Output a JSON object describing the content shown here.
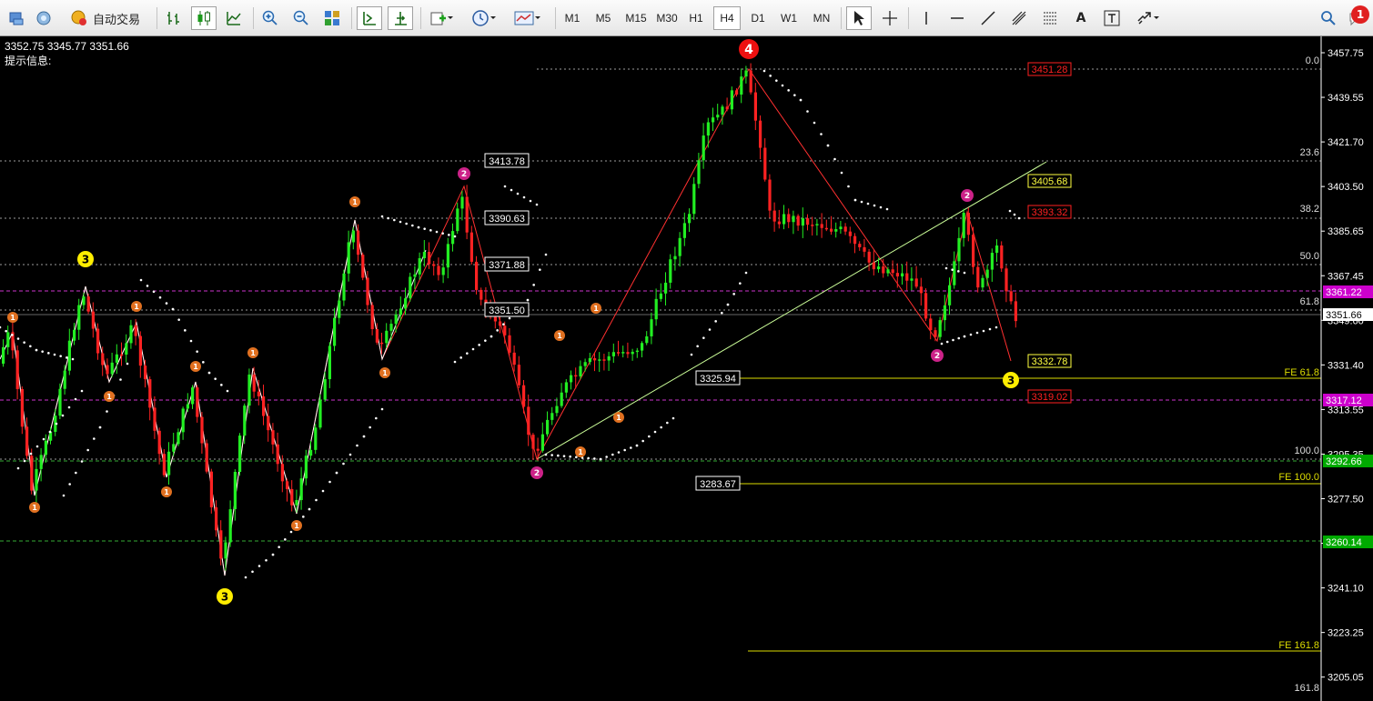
{
  "toolbar": {
    "auto_trade_label": "自动交易",
    "timeframes": [
      "M1",
      "M5",
      "M15",
      "M30",
      "H1",
      "H4",
      "D1",
      "W1",
      "MN"
    ],
    "active_timeframe": "H4",
    "notification_count": "1"
  },
  "info": {
    "ohlc_text": "3352.75 3345.77 3351.66",
    "hint_text": "提示信息:"
  },
  "price_axis": {
    "ticks": [
      "3457.75",
      "3439.55",
      "3421.70",
      "3403.50",
      "3385.65",
      "3367.45",
      "3349.60",
      "3331.40",
      "3313.55",
      "3295.35",
      "3277.50",
      "3259.30",
      "3241.10",
      "3223.25",
      "3205.05"
    ],
    "current_price": "3351.66",
    "badges": [
      {
        "label": "3361.22",
        "color": "#cc00cc"
      },
      {
        "label": "3317.12",
        "color": "#cc00cc"
      },
      {
        "label": "3292.66",
        "color": "#00aa00"
      },
      {
        "label": "3260.14",
        "color": "#00aa00"
      }
    ]
  },
  "fib_levels": [
    "0.0",
    "23.6",
    "38.2",
    "50.0",
    "61.8",
    "100.0",
    "161.8"
  ],
  "fib_prices": [
    "3413.78",
    "3390.63",
    "3371.88",
    "3351.50"
  ],
  "fe_levels": [
    {
      "label": "FE 61.8",
      "price": "3325.94"
    },
    {
      "label": "FE 100.0",
      "price": "3283.67"
    },
    {
      "label": "FE 161.8"
    }
  ],
  "target_labels": [
    {
      "label": "3451.28",
      "color": "#ff2020"
    },
    {
      "label": "3405.68",
      "color": "#ffff40"
    },
    {
      "label": "3393.32",
      "color": "#ff2020"
    },
    {
      "label": "3332.78",
      "color": "#ffff40"
    },
    {
      "label": "3319.02",
      "color": "#ff2020"
    }
  ],
  "wave_markers": [
    {
      "text": "3",
      "type": "major"
    },
    {
      "text": "3",
      "type": "major"
    },
    {
      "text": "4",
      "type": "peak"
    },
    {
      "text": "3",
      "type": "major"
    },
    {
      "text": "2",
      "type": "minor2"
    },
    {
      "text": "2",
      "type": "minor2"
    },
    {
      "text": "2",
      "type": "minor2"
    },
    {
      "text": "2",
      "type": "minor2"
    },
    {
      "text": "1",
      "type": "small"
    }
  ],
  "colors": {
    "bull": "#22ee22",
    "bear": "#ff2222",
    "grid": "#d0d0d0",
    "wave_line": "#ff3030",
    "trend_line": "#ccff99",
    "fe_line": "#dddd00",
    "magenta_line": "#cc33cc",
    "green_dash": "#33aa33"
  }
}
